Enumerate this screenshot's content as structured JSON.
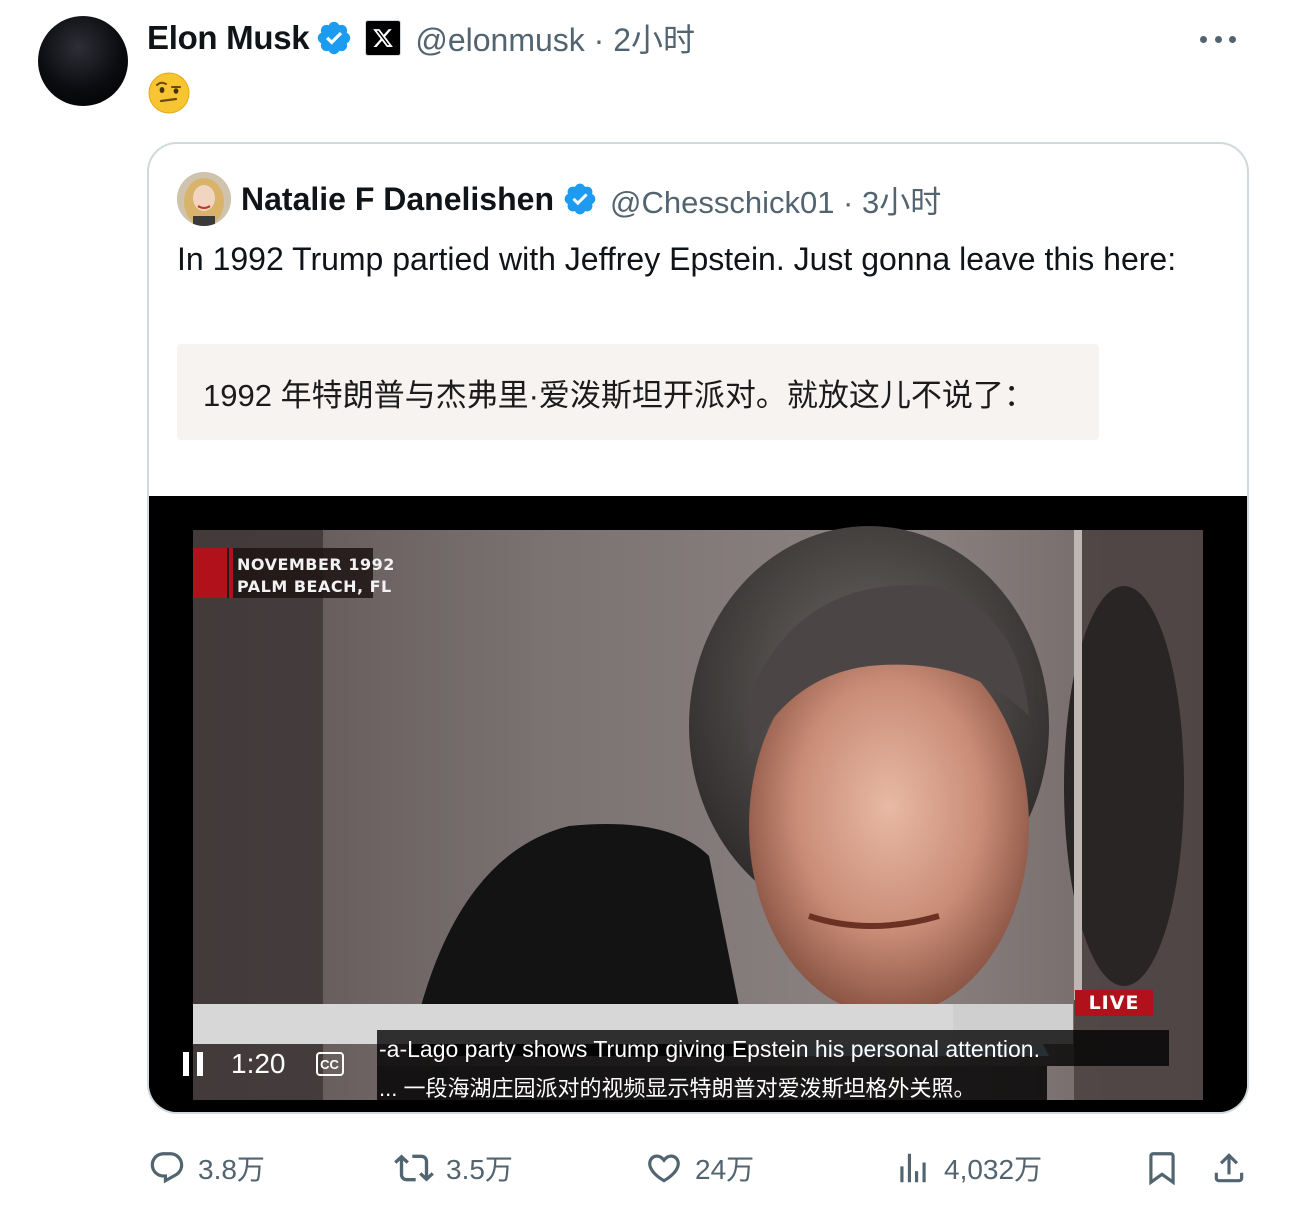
{
  "tweet": {
    "author": {
      "name": "Elon Musk",
      "handle_line": "@elonmusk · 2小时"
    },
    "emoji": "thinking-raised-eyebrow-face",
    "menu_icon": "more-dots-icon"
  },
  "quote": {
    "author": {
      "name": "Natalie F Danelishen",
      "handle_line": "@Chesschick01 · 3小时"
    },
    "text": "In 1992 Trump partied with Jeffrey Epstein. Just gonna leave this here:",
    "translation": "1992 年特朗普与杰弗里·爱泼斯坦开派对。就放这儿不说了："
  },
  "video": {
    "date_tag": [
      "NOVEMBER 1992",
      "PALM BEACH, FL"
    ],
    "live_label": "LIVE",
    "subtitle_en": "-a-Lago party shows Trump giving Epstein his personal attention.",
    "subtitle_zh": "... 一段海湖庄园派对的视频显示特朗普对爱泼斯坦格外关照。",
    "time": "1:20",
    "cc_label": "CC",
    "playing": true
  },
  "actions": {
    "replies": "3.8万",
    "reposts": "3.5万",
    "likes": "24万",
    "views": "4,032万"
  },
  "colors": {
    "verified": "#1d9bf0",
    "secondary_text": "#536471",
    "border": "#cfd9de",
    "live_red": "#b1111a"
  }
}
